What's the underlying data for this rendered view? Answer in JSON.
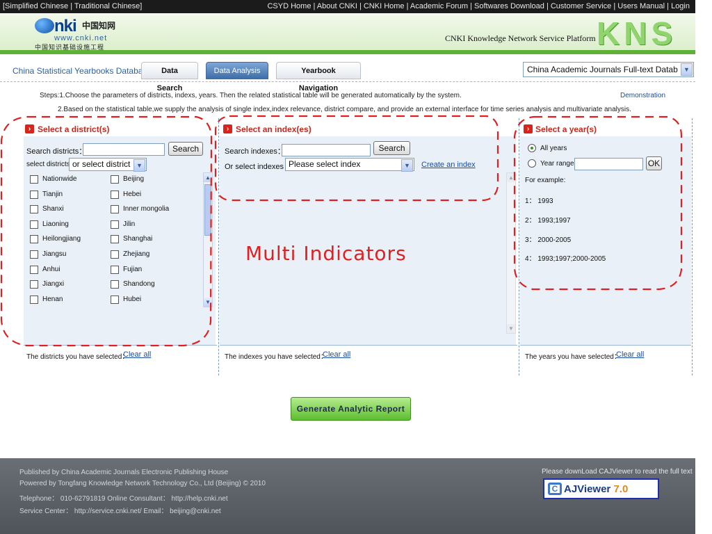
{
  "topbar": {
    "lang": "[Simplified Chinese | Traditional Chinese]",
    "links": "CSYD Home | About CNKI | CNKI Home | Academic Forum | Softwares Download | Customer Service | Users Manual | Login"
  },
  "header": {
    "logo_text": "nki",
    "logo_cn": "中国知网",
    "logo_url": "www.cnki.net",
    "logo_sub": "中国知识基础设施工程",
    "platform": "CNKI Knowledge Network Service Platform",
    "brand": "KNS"
  },
  "nav": {
    "db_title": "China Statistical Yearbooks Database",
    "tabs": [
      {
        "label": "Data Search",
        "active": false
      },
      {
        "label": "Data Analysis",
        "active": true
      },
      {
        "label": "Yearbook Navigation",
        "active": false
      }
    ],
    "db_select": "China Academic Journals Full-text Datab"
  },
  "steps": {
    "line1": "Steps:1.Choose the parameters of districts, indexs, years. Then the related statistical table will be generated automatically by the system.",
    "line2": "2.Based on the statistical table,we supply the analysis of single index,index relevance, district compare, and provide an external interface for time series analysis and multivariate analysis.",
    "demo": "Demonstration"
  },
  "district": {
    "title": "Select a district(s)",
    "search_label": "Search districts：",
    "search_button": "Search",
    "select_label": "select districts:",
    "select_value": "or select district",
    "items": [
      "Nationwide",
      "Beijing",
      "Tianjin",
      "Hebei",
      "Shanxi",
      "Inner mongolia",
      "Liaoning",
      "Jilin",
      "Heilongjiang",
      "Shanghai",
      "Jiangsu",
      "Zhejiang",
      "Anhui",
      "Fujian",
      "Jiangxi",
      "Shandong",
      "Henan",
      "Hubei"
    ],
    "selected_label": "The districts you have selected：",
    "clear": "Clear all"
  },
  "index": {
    "title": "Select an index(es)",
    "search_label": "Search indexes：",
    "search_button": "Search",
    "select_label": "Or select indexes ：",
    "select_value": "Please select index",
    "create": "Create an index",
    "selected_label": "The indexes you have selected：",
    "clear": "Clear all"
  },
  "year": {
    "title": "Select a year(s)",
    "all_years": "All years",
    "range_label": "Year range",
    "ok": "OK",
    "example_label": "For example:",
    "examples": [
      "1： 1993",
      "2： 1993;1997",
      "3： 2000-2005",
      "4： 1993;1997;2000-2005"
    ],
    "selected_label": "The years you have selected：",
    "clear": "Clear all"
  },
  "annotation": "Multi Indicators",
  "generate_button": "Generate Analytic Report",
  "footer": {
    "lines": [
      "Published by China Academic Journals Electronic Publishing House",
      "Powered by Tongfang Knowledge Network Technology Co., Ltd (Beijing) © 2010",
      "Telephone：  010-62791819 Online Consultant： http://help.cnki.net",
      "Service Center： http://service.cnki.net/ Email： beijing@cnki.net"
    ],
    "caj_text": "Please downLoad CAJViewer to read the full text",
    "caj_name": "AJViewer",
    "caj_version": "7.0"
  },
  "colors": {
    "accent_red": "#d9241b",
    "brand_green": "#5fb036",
    "tab_active": "#3d6ea8"
  }
}
